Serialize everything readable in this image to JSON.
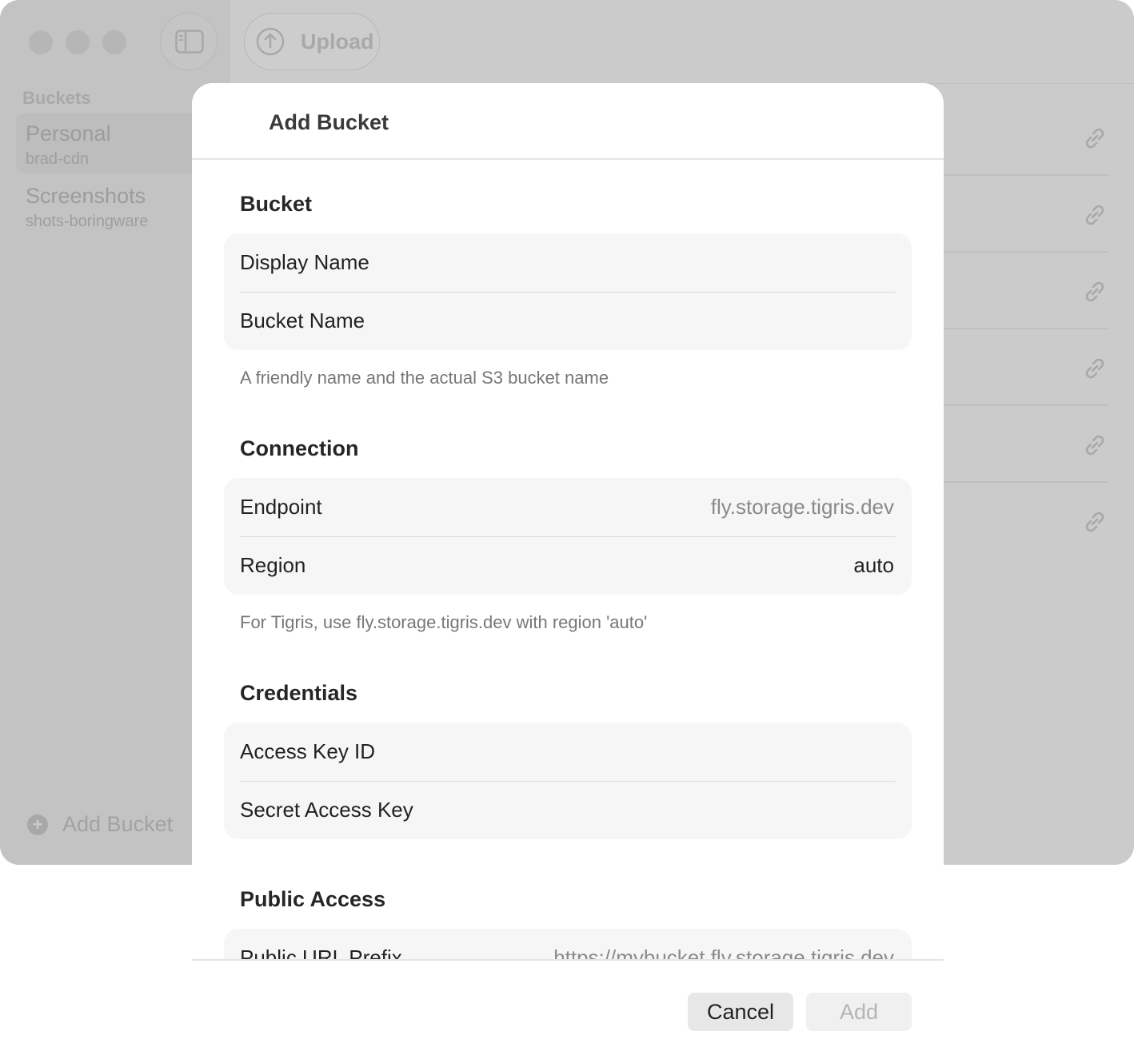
{
  "toolbar": {
    "upload_label": "Upload"
  },
  "sidebar": {
    "section_label": "Buckets",
    "items": [
      {
        "name": "Personal",
        "bucket": "brad-cdn",
        "selected": true
      },
      {
        "name": "Screenshots",
        "bucket": "shots-boringware",
        "selected": false
      }
    ],
    "add_bucket_label": "Add Bucket"
  },
  "dialog": {
    "title": "Add Bucket",
    "sections": [
      {
        "title": "Bucket",
        "fields": [
          {
            "label": "Display Name",
            "value": "",
            "placeholder": ""
          },
          {
            "label": "Bucket Name",
            "value": "",
            "placeholder": ""
          }
        ],
        "footnote": "A friendly name and the actual S3 bucket name"
      },
      {
        "title": "Connection",
        "fields": [
          {
            "label": "Endpoint",
            "value": "",
            "placeholder": "fly.storage.tigris.dev"
          },
          {
            "label": "Region",
            "value": "auto",
            "placeholder": ""
          }
        ],
        "footnote": "For Tigris, use fly.storage.tigris.dev with region 'auto'"
      },
      {
        "title": "Credentials",
        "fields": [
          {
            "label": "Access Key ID",
            "value": "",
            "placeholder": ""
          },
          {
            "label": "Secret Access Key",
            "value": "",
            "placeholder": ""
          }
        ]
      },
      {
        "title": "Public Access",
        "fields": [
          {
            "label": "Public URL Prefix",
            "value": "",
            "placeholder": "https://mybucket.fly.storage.tigris.dev"
          }
        ]
      }
    ],
    "cancel_label": "Cancel",
    "add_label": "Add"
  }
}
